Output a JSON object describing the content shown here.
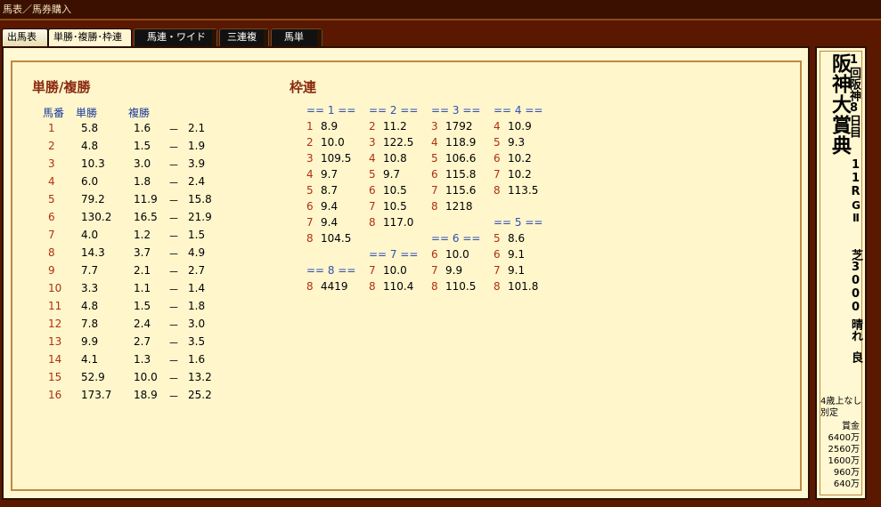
{
  "window": {
    "title": "馬表／馬券購入"
  },
  "tabs": [
    {
      "label": "出馬表"
    },
    {
      "label": "単勝･複勝･枠連"
    },
    {
      "label": "馬連・ワイド"
    },
    {
      "label": "三連複"
    },
    {
      "label": "馬単"
    }
  ],
  "win_place": {
    "title": "単勝/複勝",
    "headers": {
      "horse": "馬番",
      "win": "単勝",
      "place": "複勝"
    },
    "dash": "－",
    "rows": [
      {
        "no": "1",
        "win": "5.8",
        "pmin": "1.6",
        "pmax": "2.1"
      },
      {
        "no": "2",
        "win": "4.8",
        "pmin": "1.5",
        "pmax": "1.9"
      },
      {
        "no": "3",
        "win": "10.3",
        "pmin": "3.0",
        "pmax": "3.9"
      },
      {
        "no": "4",
        "win": "6.0",
        "pmin": "1.8",
        "pmax": "2.4"
      },
      {
        "no": "5",
        "win": "79.2",
        "pmin": "11.9",
        "pmax": "15.8"
      },
      {
        "no": "6",
        "win": "130.2",
        "pmin": "16.5",
        "pmax": "21.9"
      },
      {
        "no": "7",
        "win": "4.0",
        "pmin": "1.2",
        "pmax": "1.5"
      },
      {
        "no": "8",
        "win": "14.3",
        "pmin": "3.7",
        "pmax": "4.9"
      },
      {
        "no": "9",
        "win": "7.7",
        "pmin": "2.1",
        "pmax": "2.7"
      },
      {
        "no": "10",
        "win": "3.3",
        "pmin": "1.1",
        "pmax": "1.4"
      },
      {
        "no": "11",
        "win": "4.8",
        "pmin": "1.5",
        "pmax": "1.8"
      },
      {
        "no": "12",
        "win": "7.8",
        "pmin": "2.4",
        "pmax": "3.0"
      },
      {
        "no": "13",
        "win": "9.9",
        "pmin": "2.7",
        "pmax": "3.5"
      },
      {
        "no": "14",
        "win": "4.1",
        "pmin": "1.3",
        "pmax": "1.6"
      },
      {
        "no": "15",
        "win": "52.9",
        "pmin": "10.0",
        "pmax": "13.2"
      },
      {
        "no": "16",
        "win": "173.7",
        "pmin": "18.9",
        "pmax": "25.2"
      }
    ]
  },
  "bracket": {
    "title": "枠連",
    "groups": {
      "g1": "== 1 ==",
      "g2": "== 2 ==",
      "g3": "== 3 ==",
      "g4": "== 4 ==",
      "g5": "== 5 ==",
      "g6": "== 6 ==",
      "g7": "== 7 ==",
      "g8": "== 8 =="
    },
    "cells": [
      {
        "n": "1",
        "v": "8.9"
      },
      {
        "n": "2",
        "v": "10.0"
      },
      {
        "n": "3",
        "v": "109.5"
      },
      {
        "n": "4",
        "v": "9.7"
      },
      {
        "n": "5",
        "v": "8.7"
      },
      {
        "n": "6",
        "v": "9.4"
      },
      {
        "n": "7",
        "v": "9.4"
      },
      {
        "n": "8",
        "v": "104.5"
      },
      {
        "n": "2",
        "v": "11.2"
      },
      {
        "n": "3",
        "v": "122.5"
      },
      {
        "n": "4",
        "v": "10.8"
      },
      {
        "n": "5",
        "v": "9.7"
      },
      {
        "n": "6",
        "v": "10.5"
      },
      {
        "n": "7",
        "v": "10.5"
      },
      {
        "n": "8",
        "v": "117.0"
      },
      {
        "n": "3",
        "v": "1792"
      },
      {
        "n": "4",
        "v": "118.9"
      },
      {
        "n": "5",
        "v": "106.6"
      },
      {
        "n": "6",
        "v": "115.8"
      },
      {
        "n": "7",
        "v": "115.6"
      },
      {
        "n": "8",
        "v": "1218"
      },
      {
        "n": "4",
        "v": "10.9"
      },
      {
        "n": "5",
        "v": "9.3"
      },
      {
        "n": "6",
        "v": "10.2"
      },
      {
        "n": "7",
        "v": "10.2"
      },
      {
        "n": "8",
        "v": "113.5"
      },
      {
        "n": "5",
        "v": "8.6"
      },
      {
        "n": "6",
        "v": "9.1"
      },
      {
        "n": "7",
        "v": "9.1"
      },
      {
        "n": "8",
        "v": "101.8"
      },
      {
        "n": "6",
        "v": "10.0"
      },
      {
        "n": "7",
        "v": "9.9"
      },
      {
        "n": "8",
        "v": "110.5"
      },
      {
        "n": "7",
        "v": "10.0"
      },
      {
        "n": "8",
        "v": "110.4"
      },
      {
        "n": "8",
        "v": "4419"
      }
    ]
  },
  "race": {
    "name": "阪神大賞典",
    "meeting": "1回阪神8日目",
    "race_no": "11R",
    "grade": "GⅡ",
    "course": "芝3000",
    "weather": "晴れ",
    "going": "良",
    "condition1": "4歳上なし",
    "condition2": "別定",
    "prize_label": "賞金",
    "prizes": [
      "6400万",
      "2560万",
      "1600万",
      "960万",
      "640万"
    ]
  }
}
